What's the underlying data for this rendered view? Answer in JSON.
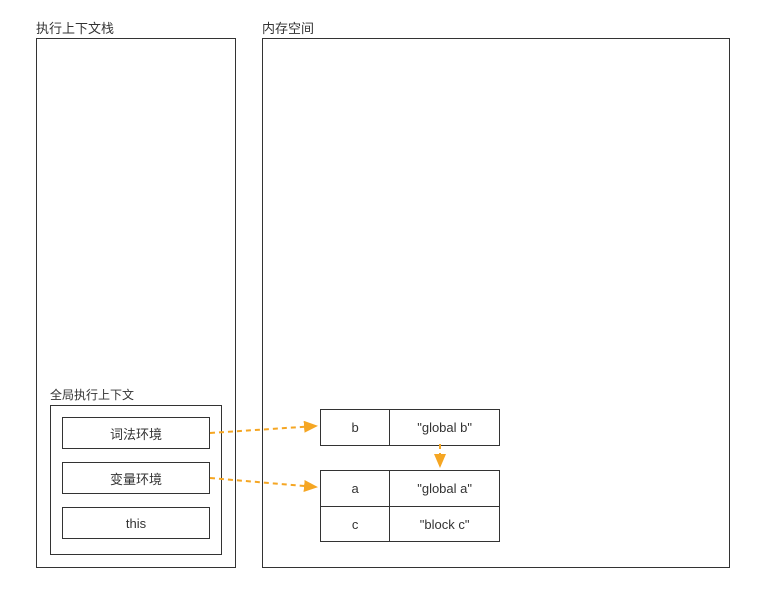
{
  "titles": {
    "stack": "执行上下文栈",
    "memory": "内存空间",
    "global_ctx": "全局执行上下文"
  },
  "envs": {
    "lexical": "词法环境",
    "variable": "变量环境",
    "this": "this"
  },
  "mem_b": {
    "rows": [
      {
        "key": "b",
        "val": "\"global b\""
      }
    ]
  },
  "mem_ac": {
    "rows": [
      {
        "key": "a",
        "val": "\"global a\""
      },
      {
        "key": "c",
        "val": "\"block c\""
      }
    ]
  },
  "colors": {
    "arrow": "#f5a623"
  }
}
